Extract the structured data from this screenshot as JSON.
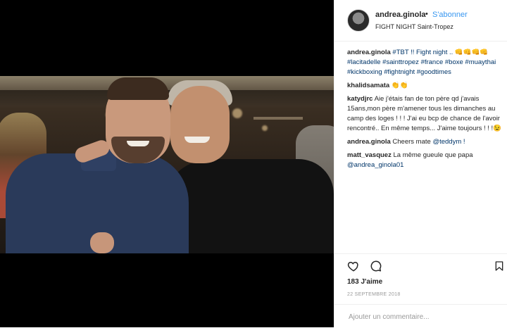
{
  "post": {
    "username": "andrea.ginola",
    "separator": "•",
    "follow_label": "S'abonner",
    "location": "FIGHT NIGHT Saint-Tropez"
  },
  "comments": [
    {
      "user": "andrea.ginola",
      "text": "#TBT !! Fight night .. 👊👊👊👊 #lacitadelle #sainttropez #france #boxe #muaythai #kickboxing #fightnight #goodtimes"
    },
    {
      "user": "khalidsamata",
      "text": "👏👏"
    },
    {
      "user": "katydjrc",
      "text": "Aie j'étais fan de ton père qd j'avais 15ans,mon père m'amener tous les dimanches au camp des loges ! ! ! J'ai eu bcp de chance de l'avoir rencontré.. En même temps... J'aime toujours ! ! !😉"
    },
    {
      "user": "andrea.ginola",
      "text": "Cheers mate",
      "mention": "@teddym !"
    },
    {
      "user": "matt_vasquez",
      "text": "La même gueule que papa",
      "mention": "@andrea_ginola01"
    }
  ],
  "stats": {
    "likes_label": "183 J'aime",
    "date": "22 SEPTEMBRE 2018"
  },
  "add_comment": {
    "placeholder": "Ajouter un commentaire..."
  },
  "icons": {
    "like": "heart-icon",
    "comment": "comment-icon",
    "save": "bookmark-icon"
  },
  "colors": {
    "link_blue": "#3897f0",
    "text": "#262626",
    "hashtag": "#003569"
  }
}
